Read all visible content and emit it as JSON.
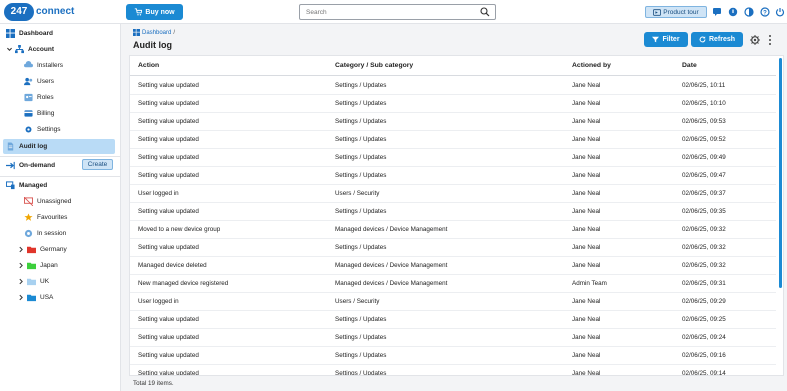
{
  "header": {
    "logo_number": "247",
    "logo_word": "connect",
    "buy_label": "Buy now",
    "search_placeholder": "Search",
    "tour_label": "Product tour"
  },
  "sidebar": {
    "dashboard": "Dashboard",
    "account": "Account",
    "account_items": [
      "Installers",
      "Users",
      "Roles",
      "Billing",
      "Settings"
    ],
    "audit_log": "Audit log",
    "on_demand": "On-demand",
    "create_label": "Create",
    "managed": "Managed",
    "managed_items": [
      "Unassigned",
      "Favourites",
      "In session"
    ],
    "groups": [
      {
        "label": "Germany",
        "color": "#e0352b"
      },
      {
        "label": "Japan",
        "color": "#3ccf3c"
      },
      {
        "label": "UK",
        "color": "#a8d1f0"
      },
      {
        "label": "USA",
        "color": "#1b8ad3"
      }
    ]
  },
  "main": {
    "breadcrumb": "Dashboard",
    "breadcrumb_sep": "/",
    "title": "Audit log",
    "filter_label": "Filter",
    "refresh_label": "Refresh",
    "columns": [
      "Action",
      "Category / Sub category",
      "Actioned by",
      "Date"
    ],
    "rows": [
      [
        "Setting value updated",
        "Settings / Updates",
        "Jane Neal",
        "02/06/25, 10:11"
      ],
      [
        "Setting value updated",
        "Settings / Updates",
        "Jane Neal",
        "02/06/25, 10:10"
      ],
      [
        "Setting value updated",
        "Settings / Updates",
        "Jane Neal",
        "02/06/25, 09:53"
      ],
      [
        "Setting value updated",
        "Settings / Updates",
        "Jane Neal",
        "02/06/25, 09:52"
      ],
      [
        "Setting value updated",
        "Settings / Updates",
        "Jane Neal",
        "02/06/25, 09:49"
      ],
      [
        "Setting value updated",
        "Settings / Updates",
        "Jane Neal",
        "02/06/25, 09:47"
      ],
      [
        "User logged in",
        "Users / Security",
        "Jane Neal",
        "02/06/25, 09:37"
      ],
      [
        "Setting value updated",
        "Settings / Updates",
        "Jane Neal",
        "02/06/25, 09:35"
      ],
      [
        "Moved to a new device group",
        "Managed devices / Device Management",
        "Jane Neal",
        "02/06/25, 09:32"
      ],
      [
        "Setting value updated",
        "Settings / Updates",
        "Jane Neal",
        "02/06/25, 09:32"
      ],
      [
        "Managed device deleted",
        "Managed devices / Device Management",
        "Jane Neal",
        "02/06/25, 09:32"
      ],
      [
        "New managed device registered",
        "Managed devices / Device Management",
        "Admin Team",
        "02/06/25, 09:31"
      ],
      [
        "User logged in",
        "Users / Security",
        "Jane Neal",
        "02/06/25, 09:29"
      ],
      [
        "Setting value updated",
        "Settings / Updates",
        "Jane Neal",
        "02/06/25, 09:25"
      ],
      [
        "Setting value updated",
        "Settings / Updates",
        "Jane Neal",
        "02/06/25, 09:24"
      ],
      [
        "Setting value updated",
        "Settings / Updates",
        "Jane Neal",
        "02/06/25, 09:16"
      ],
      [
        "Setting value updated",
        "Settings / Updates",
        "Jane Neal",
        "02/06/25, 09:14"
      ]
    ],
    "total": "Total 19 items."
  },
  "colors": {
    "accent": "#1b8ad3",
    "active_bg": "#b9dbf6",
    "brand": "#1b6fc0"
  },
  "icons": [
    "search-icon",
    "cart-icon",
    "tour-icon",
    "chat-icon",
    "notification-icon",
    "contrast-icon",
    "help-icon",
    "power-icon",
    "filter-icon",
    "refresh-icon",
    "gear-icon",
    "more-icon"
  ]
}
